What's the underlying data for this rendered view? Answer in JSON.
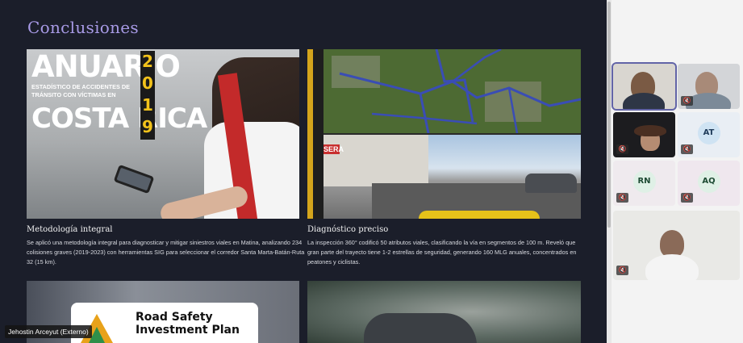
{
  "presentation": {
    "heading": "Conclusiones",
    "cards": [
      {
        "title": "Metodología integral",
        "text": "Se aplicó una metodología integral para diagnosticar y mitigar siniestros viales en Matina, analizando 234 colisiones graves (2019-2023) con herramientas SIG para seleccionar el corredor Santa Marta-Batán-Ruta 32 (15 km).",
        "image": {
          "line1": "ANUARIO",
          "line2": "ESTADÍSTICO DE ACCIDENTES DE TRÁNSITO CON VÍCTIMAS EN",
          "line3": "COSTA RICA",
          "year_digits": [
            "2",
            "0",
            "1",
            "9"
          ]
        }
      },
      {
        "title": "Diagnóstico preciso",
        "text": "La inspección 360° codificó 50 atributos viales, clasificando la vía en segmentos de 100 m. Reveló que gran parte del trayecto tiene 1-2 estrellas de seguridad, generando 160 MLG anuales, concentrados en peatones y ciclistas.",
        "image": {
          "sign": "SERA"
        }
      },
      {
        "image": {
          "line1": "Road Safety",
          "line2": "Investment Plan"
        }
      },
      {}
    ]
  },
  "participants": [
    {
      "initials": "",
      "muted": false,
      "active": true
    },
    {
      "initials": "",
      "muted": true
    },
    {
      "initials": "",
      "muted": true
    },
    {
      "initials": "AT",
      "muted": true
    },
    {
      "initials": "RN",
      "muted": true
    },
    {
      "initials": "AQ",
      "muted": true
    },
    {
      "initials": "",
      "muted": true
    }
  ],
  "presenter_name": "Jehostin Arceyut (Externo)",
  "colors": {
    "accent": "#6264a7",
    "slide_bg": "#1b1e2a",
    "heading": "#a89ae6",
    "year": "#f2c21b"
  }
}
